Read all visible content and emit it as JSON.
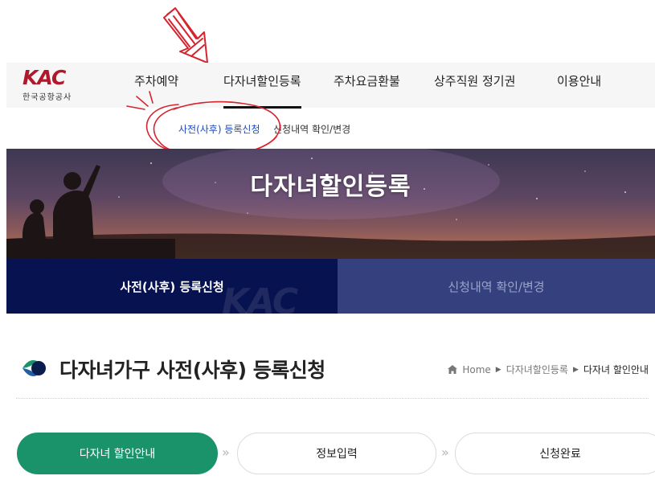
{
  "header": {
    "logo_mark": "KAC",
    "logo_text": "한국공항공사",
    "nav": [
      {
        "label": "주차예약"
      },
      {
        "label": "다자녀할인등록"
      },
      {
        "label": "주차요금환불"
      },
      {
        "label": "상주직원 정기권"
      },
      {
        "label": "이용안내"
      }
    ],
    "active_nav": "다자녀할인등록"
  },
  "subnav": {
    "items": [
      {
        "label": "사전(사후) 등록신청"
      },
      {
        "label": "신청내역 확인/변경"
      }
    ],
    "active_color": "#1f47b9"
  },
  "banner": {
    "title": "다자녀할인등록"
  },
  "tabs": {
    "items": [
      {
        "label": "사전(사후) 등록신청"
      },
      {
        "label": "신청내역 확인/변경"
      }
    ],
    "active_color": "#071250",
    "inactive_color": "#35407f"
  },
  "page": {
    "title": "다자녀가구 사전(사후) 등록신청",
    "breadcrumb": [
      "Home",
      "다자녀할인등록",
      "다자녀 할인안내"
    ]
  },
  "steps": {
    "items": [
      {
        "label": "다자녀 할인안내"
      },
      {
        "label": "정보입력"
      },
      {
        "label": "신청완료"
      }
    ],
    "active_color": "#1a936b"
  },
  "icons": {
    "home": "home-icon",
    "breadcrumb_separator": "triangle-right-icon",
    "step_separator": "double-chevron-right-icon",
    "title_icon": "kac-leaf-icon"
  },
  "brand_colors": {
    "logo_red": "#b1182c",
    "annotation_red": "#d6242f"
  }
}
